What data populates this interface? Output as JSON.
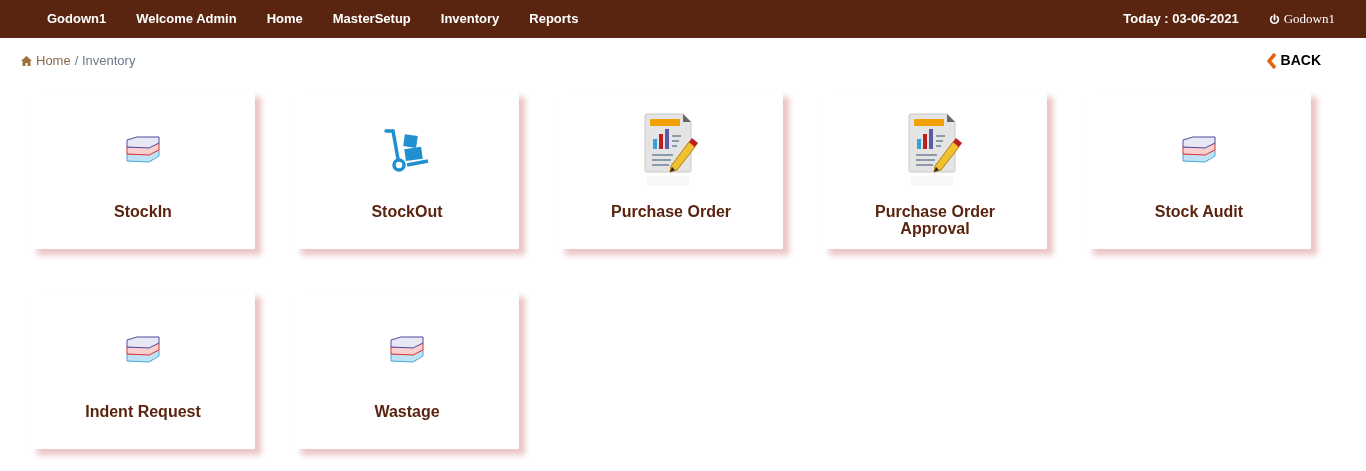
{
  "navbar": {
    "brand": "Godown1",
    "welcome": "Welcome Admin",
    "menu": [
      "Home",
      "MasterSetup",
      "Inventory",
      "Reports"
    ],
    "today": "Today : 03-06-2021",
    "user": "Godown1"
  },
  "breadcrumb": {
    "home": "Home",
    "current": "/ Inventory"
  },
  "back_button": "BACK",
  "tiles": [
    {
      "label": "StockIn",
      "kind": "books"
    },
    {
      "label": "StockOut",
      "kind": "trolley"
    },
    {
      "label": "Purchase Order",
      "kind": "report"
    },
    {
      "label": "Purchase Order Approval",
      "kind": "report"
    },
    {
      "label": "Stock Audit",
      "kind": "books"
    },
    {
      "label": "Indent Request",
      "kind": "books"
    },
    {
      "label": "Wastage",
      "kind": "books"
    }
  ]
}
